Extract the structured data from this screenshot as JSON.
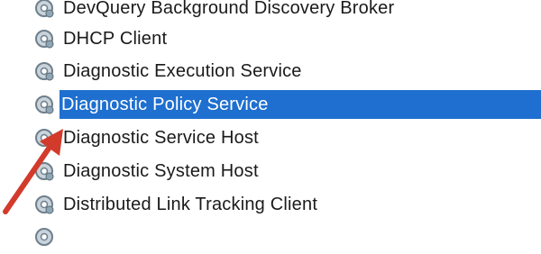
{
  "services": {
    "items": [
      {
        "label": "DevQuery Background Discovery Broker",
        "icon": "gear-icon",
        "selected": false
      },
      {
        "label": "DHCP Client",
        "icon": "gear-icon",
        "selected": false
      },
      {
        "label": "Diagnostic Execution Service",
        "icon": "gear-icon",
        "selected": false
      },
      {
        "label": "Diagnostic Policy Service",
        "icon": "gear-icon",
        "selected": true
      },
      {
        "label": "Diagnostic Service Host",
        "icon": "gear-icon",
        "selected": false
      },
      {
        "label": "Diagnostic System Host",
        "icon": "gear-icon",
        "selected": false
      },
      {
        "label": "Distributed Link Tracking Client",
        "icon": "gear-icon",
        "selected": false
      }
    ]
  },
  "colors": {
    "selection": "#1e6fcf",
    "arrow": "#d23b2b"
  }
}
